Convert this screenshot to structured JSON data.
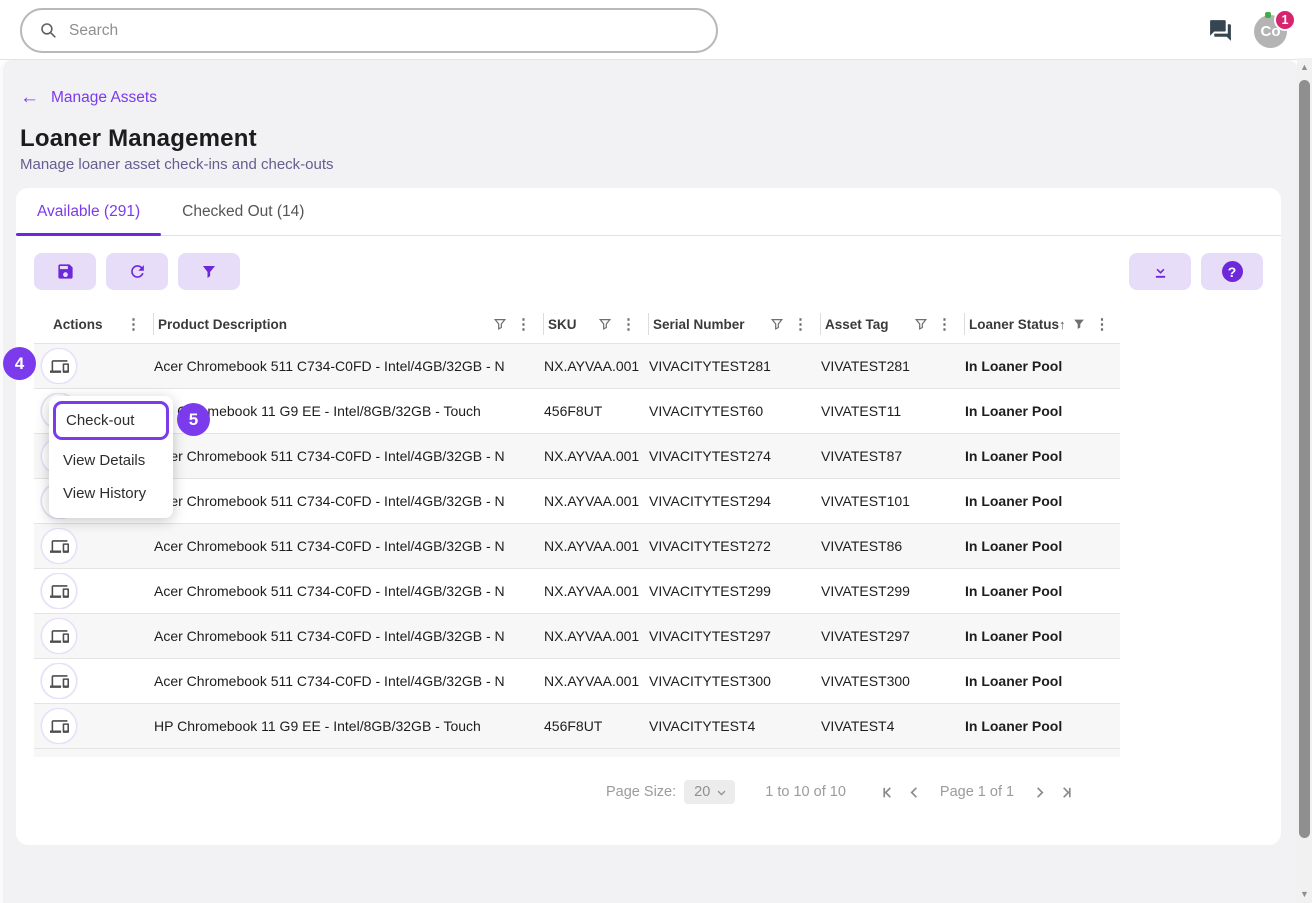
{
  "topbar": {
    "search_placeholder": "Search",
    "avatar_text": "Co",
    "notification_count": "1",
    "icons": [
      "search-icon",
      "chat-icon",
      "avatar"
    ]
  },
  "page": {
    "back_link": "Manage Assets",
    "title": "Loaner Management",
    "subtitle": "Manage loaner asset check-ins and check-outs"
  },
  "tabs": [
    {
      "label": "Available (291)",
      "active": true
    },
    {
      "label": "Checked Out (14)",
      "active": false
    }
  ],
  "toolbar": {
    "left_icons": [
      "save-icon",
      "refresh-icon",
      "filter-icon"
    ],
    "right_icons": [
      "download-icon",
      "help-icon"
    ]
  },
  "table": {
    "columns": [
      {
        "label": "Actions"
      },
      {
        "label": "Product Description"
      },
      {
        "label": "SKU"
      },
      {
        "label": "Serial Number"
      },
      {
        "label": "Asset Tag"
      },
      {
        "label": "Loaner Status",
        "sorted": "asc",
        "filtered": true
      }
    ],
    "rows": [
      {
        "product": "Acer Chromebook 511 C734-C0FD - Intel/4GB/32GB - N",
        "sku": "NX.AYVAA.001",
        "serial": "VIVACITYTEST281",
        "asset_tag": "VIVATEST281",
        "status": "In Loaner Pool"
      },
      {
        "product": "HP Chromebook 11 G9 EE - Intel/8GB/32GB - Touch",
        "sku": "456F8UT",
        "serial": "VIVACITYTEST60",
        "asset_tag": "VIVATEST11",
        "status": "In Loaner Pool"
      },
      {
        "product": "Acer Chromebook 511 C734-C0FD - Intel/4GB/32GB - N",
        "sku": "NX.AYVAA.001",
        "serial": "VIVACITYTEST274",
        "asset_tag": "VIVATEST87",
        "status": "In Loaner Pool"
      },
      {
        "product": "Acer Chromebook 511 C734-C0FD - Intel/4GB/32GB - N",
        "sku": "NX.AYVAA.001",
        "serial": "VIVACITYTEST294",
        "asset_tag": "VIVATEST101",
        "status": "In Loaner Pool"
      },
      {
        "product": "Acer Chromebook 511 C734-C0FD - Intel/4GB/32GB - N",
        "sku": "NX.AYVAA.001",
        "serial": "VIVACITYTEST272",
        "asset_tag": "VIVATEST86",
        "status": "In Loaner Pool"
      },
      {
        "product": "Acer Chromebook 511 C734-C0FD - Intel/4GB/32GB - N",
        "sku": "NX.AYVAA.001",
        "serial": "VIVACITYTEST299",
        "asset_tag": "VIVATEST299",
        "status": "In Loaner Pool"
      },
      {
        "product": "Acer Chromebook 511 C734-C0FD - Intel/4GB/32GB - N",
        "sku": "NX.AYVAA.001",
        "serial": "VIVACITYTEST297",
        "asset_tag": "VIVATEST297",
        "status": "In Loaner Pool"
      },
      {
        "product": "Acer Chromebook 511 C734-C0FD - Intel/4GB/32GB - N",
        "sku": "NX.AYVAA.001",
        "serial": "VIVACITYTEST300",
        "asset_tag": "VIVATEST300",
        "status": "In Loaner Pool"
      },
      {
        "product": "HP Chromebook 11 G9 EE - Intel/8GB/32GB - Touch",
        "sku": "456F8UT",
        "serial": "VIVACITYTEST4",
        "asset_tag": "VIVATEST4",
        "status": "In Loaner Pool"
      }
    ]
  },
  "context_menu": {
    "items": [
      "Check-out",
      "View Details",
      "View History"
    ],
    "highlighted": "Check-out"
  },
  "annotations": {
    "step4": "4",
    "step5": "5"
  },
  "pagination": {
    "page_size_label": "Page Size:",
    "page_size": "20",
    "range": "1 to 10 of 10",
    "page_info": "Page 1 of 1"
  },
  "colors": {
    "accent": "#7c3aed",
    "accent_dark": "#6d28d9",
    "toolbar_button_bg": "#e7ddf9",
    "notification_badge": "#d6246e",
    "row_alt": "#f7f7f7"
  }
}
